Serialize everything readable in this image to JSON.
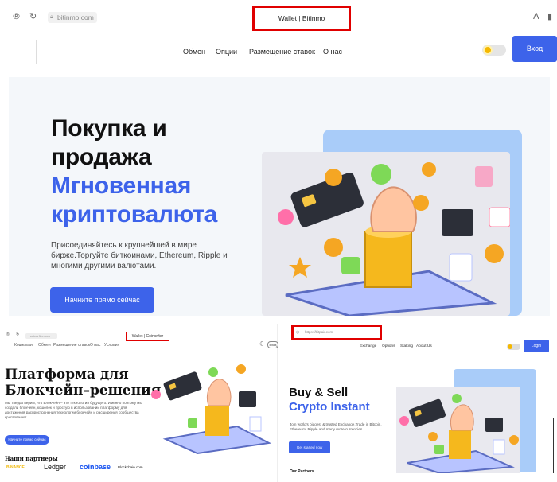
{
  "top": {
    "url": "bitinmo.com",
    "tab_title": "Wallet | Bitinmo",
    "nav": [
      "Обмен",
      "Опции",
      "Размещение ставок",
      "О нас"
    ],
    "login_button": "Вход",
    "hero": {
      "line1": "Покупка и",
      "line2": "продажа",
      "line3": "Мгновенная",
      "line4": "криптовалюта",
      "description": "Присоединяйтесь к крупнейшей в мире бирже.Торгуйте биткоинами, Ethereum, Ripple и многими другими валютами.",
      "cta": "Начните прямо сейчас"
    }
  },
  "bottom_left": {
    "url": "coincrfter.com",
    "tab_title": "Wallet | Coincrfter",
    "nav": [
      "Кошельки",
      "Обмен",
      "Размещение ставок",
      "О нас",
      "Условия"
    ],
    "login_button": "Вход",
    "title_line1": "Платформа для",
    "title_line2": "Блокчейн–решения",
    "description": "Мы твердо верим, что Блокчейн – это технология будущего. Именно поэтому мы создали блокчейн, кошелек и простую в использовании платформу для достижения распространения технологии блокчейн и расширения сообщества криптовалют.",
    "cta": "Начните прямо сейчас",
    "partners_title": "Наши партнеры",
    "partners": [
      "BINANCE",
      "Ledger",
      "coinbase",
      "Blockchain.com"
    ]
  },
  "bottom_right": {
    "url": "https://bitpair.com",
    "nav": [
      "Exchange",
      "Options",
      "Staking",
      "About Us"
    ],
    "login_button": "Login",
    "title_line1": "Buy & Sell",
    "title_line2": "Crypto Instant",
    "description": "Join world's biggest & trusted Exchange.Trade in Bitcoin, Ethereum, Ripple and many more currencies.",
    "cta": "Get started now",
    "partners_title": "Our Partners"
  }
}
